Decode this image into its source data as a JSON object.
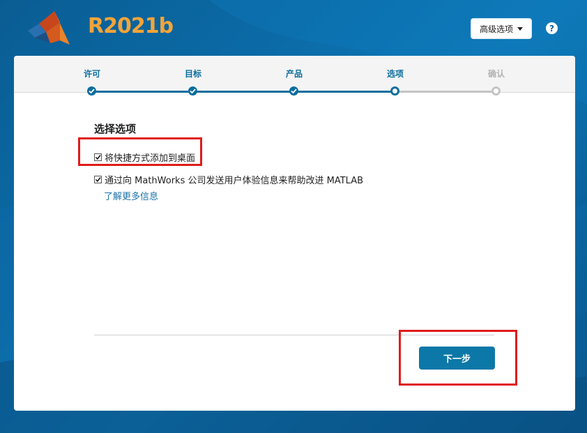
{
  "header": {
    "brand": "R2021b",
    "advanced_options_label": "高级选项",
    "help_label": "?"
  },
  "steps": [
    {
      "label": "许可",
      "state": "done"
    },
    {
      "label": "目标",
      "state": "done"
    },
    {
      "label": "产品",
      "state": "done"
    },
    {
      "label": "选项",
      "state": "current"
    },
    {
      "label": "确认",
      "state": "todo"
    }
  ],
  "content": {
    "section_title": "选择选项",
    "options": [
      {
        "label": "将快捷方式添加到桌面",
        "checked": true
      },
      {
        "label": "通过向 MathWorks 公司发送用户体验信息来帮助改进 MATLAB",
        "checked": true
      }
    ],
    "learn_more_link": "了解更多信息"
  },
  "footer": {
    "next_label": "下一步"
  },
  "colors": {
    "accent": "#0c6e9e",
    "button": "#0c78a8",
    "highlight": "#e01b1b",
    "brand": "#f3a43a"
  }
}
